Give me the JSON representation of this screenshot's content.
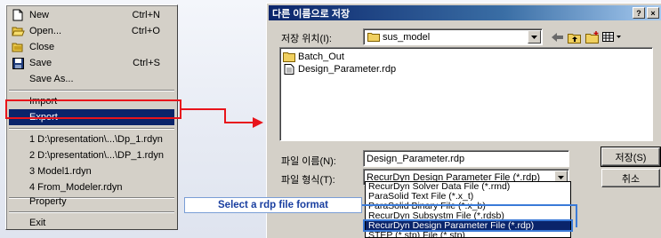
{
  "menu": {
    "items": [
      {
        "label": "New",
        "shortcut": "Ctrl+N",
        "icon": "new-file-icon"
      },
      {
        "label": "Open...",
        "shortcut": "Ctrl+O",
        "icon": "open-folder-icon"
      },
      {
        "label": "Close",
        "shortcut": "",
        "icon": "close-file-icon"
      },
      {
        "label": "Save",
        "shortcut": "Ctrl+S",
        "icon": "save-disk-icon"
      },
      {
        "label": "Save As...",
        "shortcut": "",
        "icon": ""
      },
      {
        "label": "Import",
        "shortcut": "",
        "icon": ""
      },
      {
        "label": "Export",
        "shortcut": "",
        "icon": ""
      },
      {
        "label": "1 D:\\presentation\\...\\Dp_1.rdyn",
        "shortcut": "",
        "icon": ""
      },
      {
        "label": "2 D:\\presentation\\...\\DP_1.rdyn",
        "shortcut": "",
        "icon": ""
      },
      {
        "label": "3 Model1.rdyn",
        "shortcut": "",
        "icon": ""
      },
      {
        "label": "4 From_Modeler.rdyn",
        "shortcut": "",
        "icon": ""
      },
      {
        "label": "Property",
        "shortcut": "",
        "icon": ""
      },
      {
        "label": "Exit",
        "shortcut": "",
        "icon": ""
      }
    ],
    "selected": "Export"
  },
  "dialog": {
    "title": "다른 이름으로 저장",
    "help_label": "?",
    "close_label": "×",
    "save_in_label": "저장 위치(I):",
    "save_in_value": "sus_model",
    "files": [
      {
        "name": "Batch_Out",
        "type": "folder"
      },
      {
        "name": "Design_Parameter.rdp",
        "type": "file"
      }
    ],
    "filename_label": "파일 이름(N):",
    "filename_value": "Design_Parameter.rdp",
    "filetype_label": "파일 형식(T):",
    "filetype_value": "RecurDyn Design Parameter File (*.rdp)",
    "save_button": "저장(S)",
    "cancel_button": "취소",
    "filetype_options": [
      "RecurDyn Solver Data File (*.rmd)",
      "ParaSolid Text File (*.x_t)",
      "ParaSolid Binary File (*.x_b)",
      "RecurDyn Subsystm File (*.rdsb)",
      "RecurDyn Design Parameter File (*.rdp)",
      "STEP (*.stp) File (*.stp)"
    ],
    "selected_filetype": "RecurDyn Design Parameter File (*.rdp)"
  },
  "annotation": {
    "callout_text": "Select a rdp file format"
  },
  "colors": {
    "highlight_red": "#e8141b",
    "highlight_blue": "#3a7ad8",
    "selection_navy": "#0a246a"
  }
}
